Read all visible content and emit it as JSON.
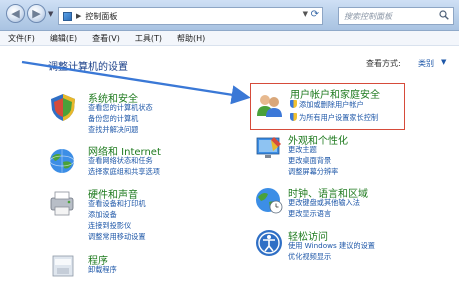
{
  "address": {
    "path": "控制面板",
    "refresh_icon": "refresh-icon"
  },
  "search": {
    "placeholder": "搜索控制面板"
  },
  "menu": [
    "文件(F)",
    "编辑(E)",
    "查看(V)",
    "工具(T)",
    "帮助(H)"
  ],
  "page_title": "调整计算机的设置",
  "view_by": {
    "label": "查看方式:",
    "value": "类别"
  },
  "categories": [
    {
      "title": "系统和安全",
      "icon": "system-security-icon",
      "links": [
        "查看您的计算机状态",
        "备份您的计算机",
        "查找并解决问题"
      ]
    },
    {
      "title": "网络和 Internet",
      "icon": "network-internet-icon",
      "links": [
        "查看网络状态和任务",
        "选择家庭组和共享选项"
      ]
    },
    {
      "title": "硬件和声音",
      "icon": "hardware-sound-icon",
      "links": [
        "查看设备和打印机",
        "添加设备",
        "连接到投影仪",
        "调整常用移动设置"
      ]
    },
    {
      "title": "程序",
      "icon": "programs-icon",
      "links": [
        "卸载程序"
      ]
    },
    {
      "title": "用户帐户和家庭安全",
      "icon": "user-accounts-icon",
      "links": [
        "添加或删除用户帐户",
        "为所有用户设置家长控制"
      ],
      "highlight_color": "#d64b3a"
    },
    {
      "title": "外观和个性化",
      "icon": "appearance-icon",
      "links": [
        "更改主题",
        "更改桌面背景",
        "调整屏幕分辨率"
      ]
    },
    {
      "title": "时钟、语言和区域",
      "icon": "clock-language-icon",
      "links": [
        "更改键盘或其他输入法",
        "更改显示语言"
      ]
    },
    {
      "title": "轻松访问",
      "icon": "ease-of-access-icon",
      "links": [
        "使用 Windows 建议的设置",
        "优化视频显示"
      ]
    }
  ],
  "colors": {
    "link": "#1e57a8",
    "category_title": "#1e7a1e",
    "page_title": "#1a3f88",
    "arrow": "#3a78d6"
  }
}
